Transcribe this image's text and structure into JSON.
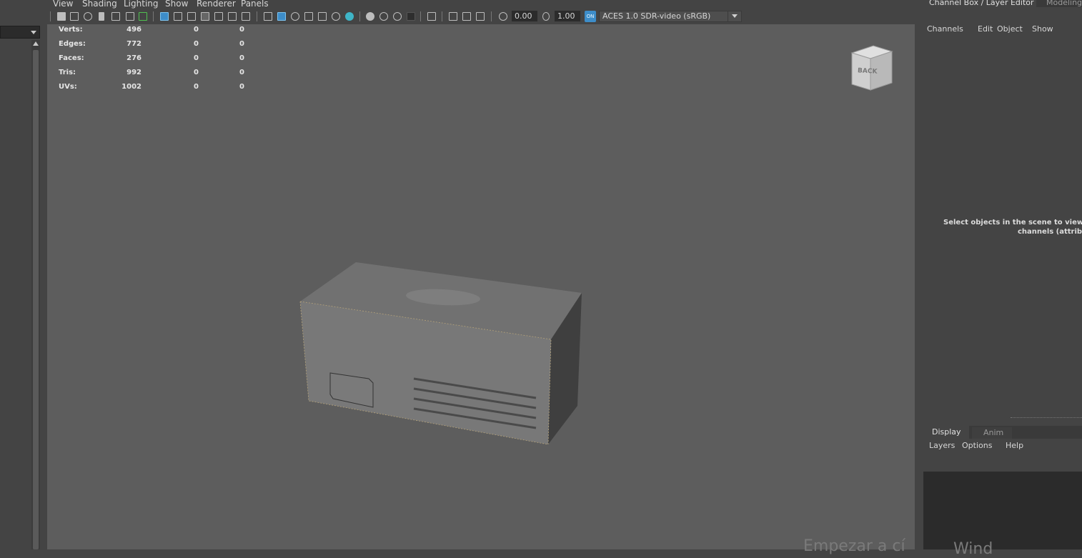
{
  "viewport": {
    "menu": [
      "View",
      "Shading",
      "Lighting",
      "Show",
      "Renderer",
      "Panels"
    ],
    "toolbar": {
      "exposure_value": "0.00",
      "gamma_value": "1.00",
      "color_management_toggle": "ON",
      "color_transform": "ACES 1.0 SDR-video (sRGB)"
    },
    "hud": [
      {
        "label": "Verts:",
        "values": [
          "496",
          "0",
          "0"
        ]
      },
      {
        "label": "Edges:",
        "values": [
          "772",
          "0",
          "0"
        ]
      },
      {
        "label": "Faces:",
        "values": [
          "276",
          "0",
          "0"
        ]
      },
      {
        "label": "Tris:",
        "values": [
          "992",
          "0",
          "0"
        ]
      },
      {
        "label": "UVs:",
        "values": [
          "1002",
          "0",
          "0"
        ]
      }
    ],
    "viewcube_label": "BACK",
    "activation_watermark": "Empezar a cí"
  },
  "channel_box": {
    "tab_label": "Channel Box / Layer Editor",
    "other_tab_label": "Modeling",
    "menu": [
      "Channels",
      "Edit",
      "Object",
      "Show"
    ],
    "message_line1": "Select objects in the scene to view, ed",
    "message_line2": "channels (attribut"
  },
  "layer_editor": {
    "tabs": [
      "Display",
      "Anim"
    ],
    "menu": [
      "Layers",
      "Options",
      "Help"
    ],
    "watermark": "Wind"
  },
  "colors": {
    "viewport_bg": "#5d5d5d",
    "ui_bg": "#444444",
    "highlight": "#3d8dc9",
    "model_front": "#777777",
    "model_side": "#3f3f3f",
    "model_top": "#707070"
  }
}
